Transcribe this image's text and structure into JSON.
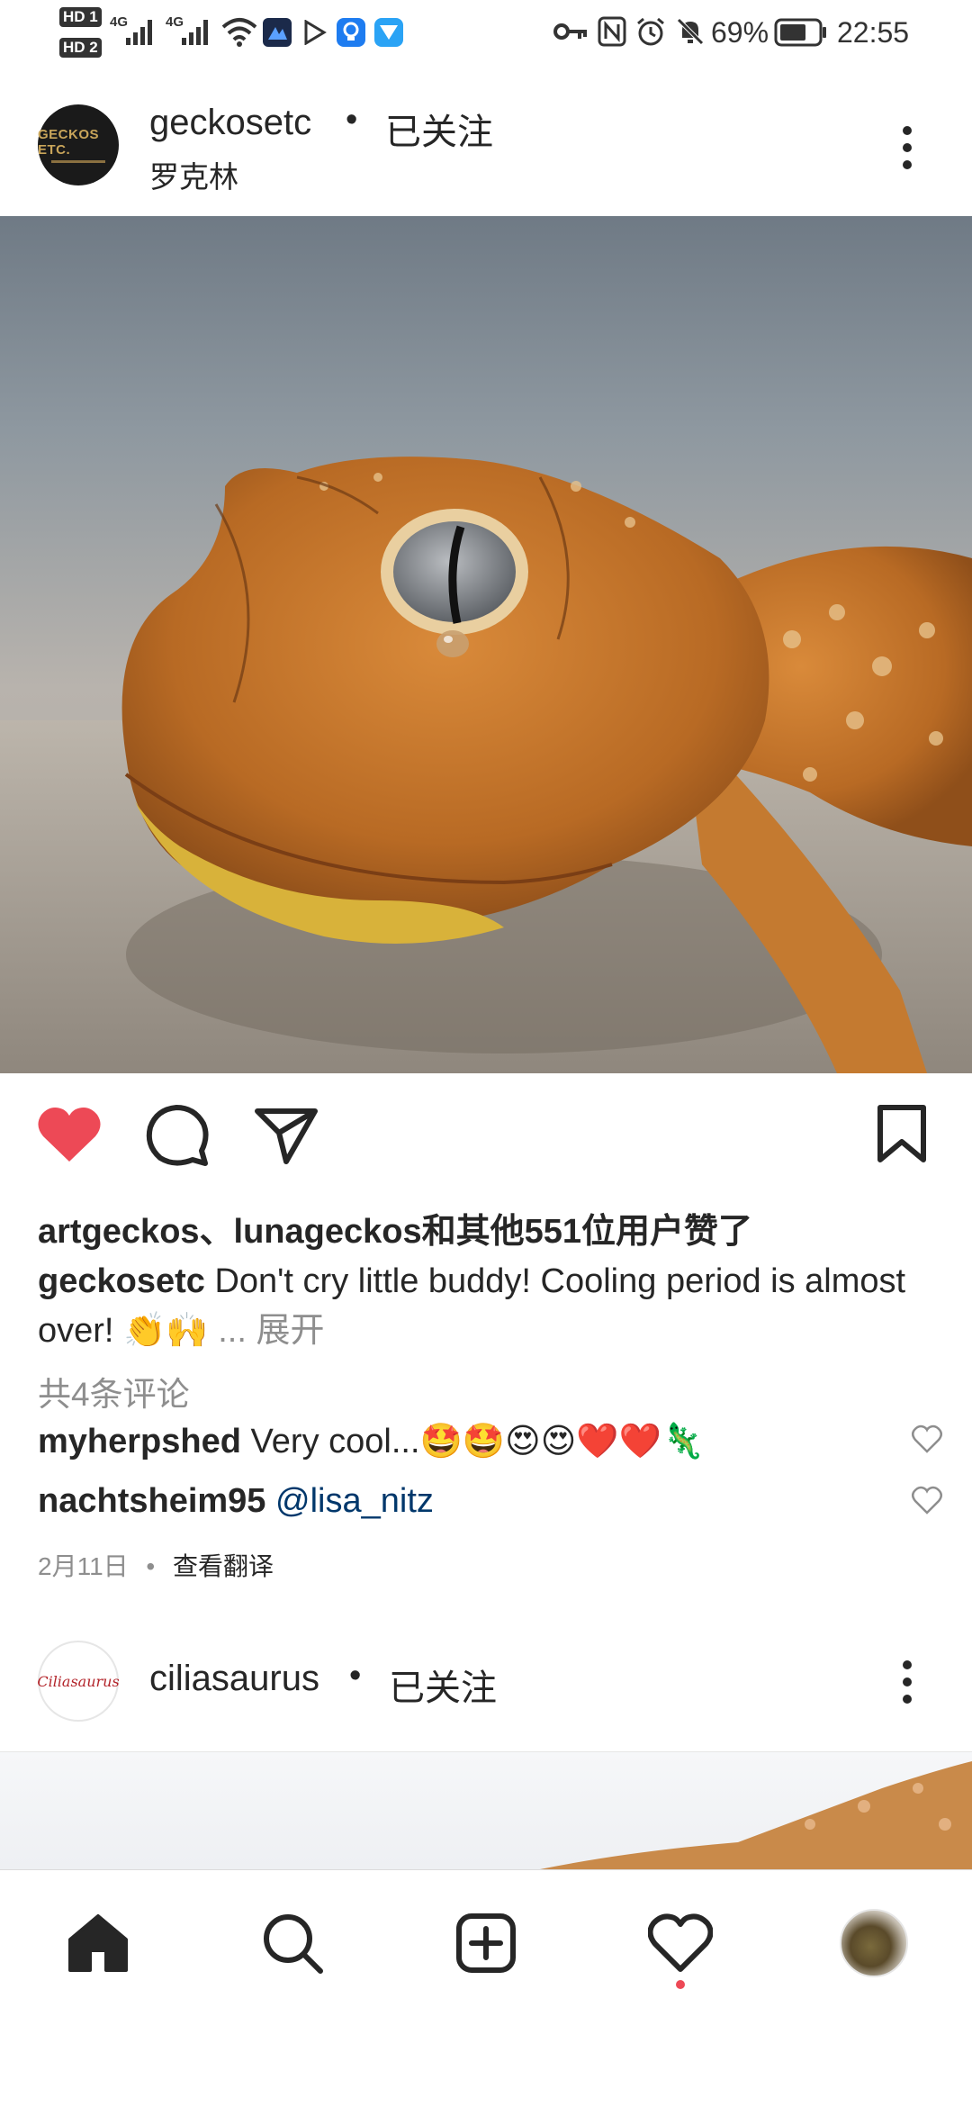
{
  "status_bar": {
    "hd1": "HD 1",
    "hd2": "HD 2",
    "net1": "4G",
    "net2": "4G",
    "battery": "69%",
    "time": "22:55",
    "icons": [
      "signal-icon",
      "wifi-icon",
      "app-icon",
      "play-icon",
      "bulb-icon",
      "message-app-icon",
      "key-icon",
      "nfc-icon",
      "alarm-icon",
      "mute-icon",
      "battery-icon"
    ]
  },
  "post1": {
    "avatar_text": "GECKOS ETC.",
    "username": "geckosetc",
    "separator": "•",
    "follow_status": "已关注",
    "location": "罗克林",
    "likes_text": "artgeckos、lunageckos和其他551位用户赞了",
    "caption_user": "geckosetc",
    "caption_text": "Don't cry little buddy! Cooling period is almost over! 👏🙌",
    "caption_more": "... 展开",
    "comments_count": "共4条评论",
    "comments": [
      {
        "user": "myherpshed",
        "text": "Very cool...🤩🤩😍😍❤️❤️🦎"
      },
      {
        "user": "nachtsheim95",
        "text": "@lisa_nitz"
      }
    ],
    "date": "2月11日",
    "meta_separator": "•",
    "translate": "查看翻译"
  },
  "post2": {
    "avatar_text": "Ciliasaurus",
    "username": "ciliasaurus",
    "separator": "•",
    "follow_status": "已关注"
  },
  "colors": {
    "like_red": "#ed4956",
    "text": "#262626",
    "secondary": "#8e8e8e",
    "link": "#00376b"
  },
  "nav": [
    "home-icon",
    "search-icon",
    "new-post-icon",
    "activity-icon",
    "profile-avatar"
  ]
}
